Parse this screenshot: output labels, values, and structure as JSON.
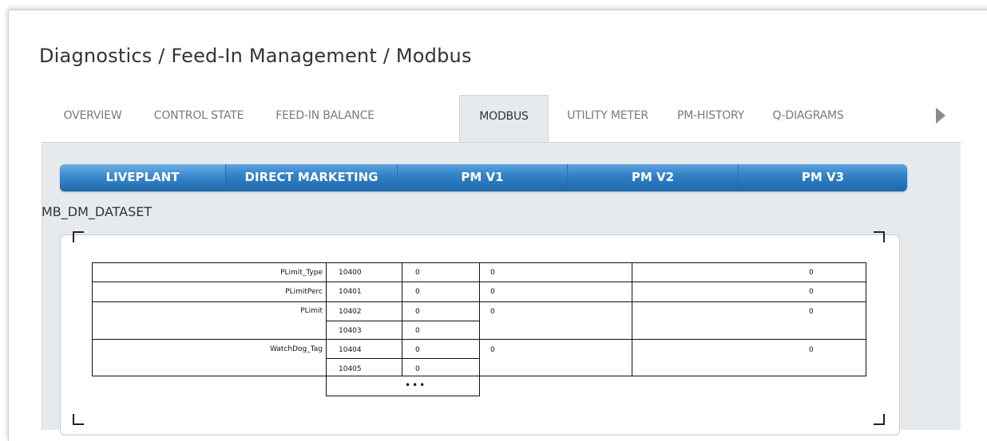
{
  "header": {
    "breadcrumb": "Diagnostics / Feed-In Management / Modbus"
  },
  "tabs": [
    {
      "label": "OVERVIEW",
      "active": false
    },
    {
      "label": "CONTROL STATE",
      "active": false
    },
    {
      "label": "FEED-IN BALANCE",
      "active": false
    },
    {
      "label": "MODBUS",
      "active": true
    },
    {
      "label": "UTILITY METER",
      "active": false
    },
    {
      "label": "PM-HISTORY",
      "active": false
    },
    {
      "label": "Q-DIAGRAMS",
      "active": false
    }
  ],
  "subtabs": [
    {
      "label": "LIVEPLANT"
    },
    {
      "label": "DIRECT MARKETING"
    },
    {
      "label": "PM V1"
    },
    {
      "label": "PM V2"
    },
    {
      "label": "PM V3"
    }
  ],
  "dataset": {
    "label": "MB_DM_DATASET"
  },
  "registers": [
    {
      "name": "PLimit_Type",
      "address": "10400",
      "value": "0",
      "col3": "0",
      "col5": "0"
    },
    {
      "name": "PLimitPerc",
      "address": "10401",
      "value": "0",
      "col3": "0",
      "col5": "0"
    },
    {
      "name": "PLimit",
      "address": "10402",
      "value": "0",
      "col3": "0",
      "col5": "0"
    },
    {
      "name": "",
      "address": "10403",
      "value": "0",
      "col3": "",
      "col5": ""
    },
    {
      "name": "WatchDog_Tag",
      "address": "10404",
      "value": "0",
      "col3": "0",
      "col5": "0"
    },
    {
      "name": "",
      "address": "10405",
      "value": "0",
      "col3": "",
      "col5": ""
    }
  ],
  "continuation": "•••",
  "colors": {
    "accent": "#2f7fc5",
    "panel": "#e7eaed"
  }
}
